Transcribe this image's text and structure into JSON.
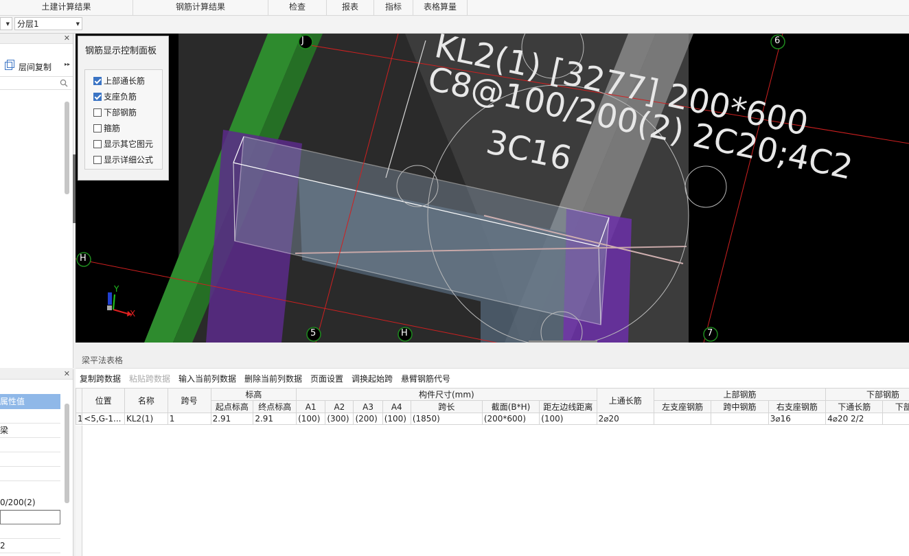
{
  "top_tabs": [
    "土建计算结果",
    "钢筋计算结果",
    "检查",
    "报表",
    "指标",
    "表格算量"
  ],
  "floor_select": "分层1",
  "left_panel": {
    "layer_copy": "层间复制",
    "expand_glyph": "▸▸",
    "search_icon": "search-icon",
    "prop_header": "属性值",
    "prop_values": [
      "",
      "梁",
      "",
      "",
      "",
      "0/200(2)",
      "",
      "",
      "2"
    ]
  },
  "control_panel": {
    "title": "钢筋显示控制面板",
    "items": [
      {
        "label": "上部通长筋",
        "checked": true
      },
      {
        "label": "支座负筋",
        "checked": true
      },
      {
        "label": "下部钢筋",
        "checked": false
      },
      {
        "label": "箍筋",
        "checked": false
      },
      {
        "label": "显示其它图元",
        "checked": false
      },
      {
        "label": "显示详细公式",
        "checked": false
      }
    ]
  },
  "viewport": {
    "annotation_lines": [
      "KL2(1) [3277] 200*600",
      "C8@100/200(2) 2C20;4C2",
      "3C16"
    ],
    "axis_markers": [
      "J",
      "6",
      "H",
      "5",
      "H",
      "7"
    ],
    "axes": {
      "x": "X",
      "y": "Y"
    },
    "colors": {
      "beam_purple": "#6b2fa8",
      "column_green": "#2e8b2e",
      "grid_line": "#d02020",
      "axis_marker": "#1e8a1e"
    }
  },
  "bottom_panel": {
    "title": "梁平法表格",
    "toolbar": [
      {
        "label": "复制跨数据",
        "enabled": true
      },
      {
        "label": "粘贴跨数据",
        "enabled": false
      },
      {
        "label": "输入当前列数据",
        "enabled": true
      },
      {
        "label": "删除当前列数据",
        "enabled": true
      },
      {
        "label": "页面设置",
        "enabled": true
      },
      {
        "label": "调换起始跨",
        "enabled": true
      },
      {
        "label": "悬臂钢筋代号",
        "enabled": true
      }
    ],
    "group_headers": {
      "elevation": "标高",
      "size": "构件尺寸(mm)",
      "top_rebar": "上部钢筋",
      "bottom_rebar": "下部钢筋"
    },
    "col_headers": {
      "position": "位置",
      "name": "名称",
      "span_no": "跨号",
      "start_elev": "起点标高",
      "end_elev": "终点标高",
      "a1": "A1",
      "a2": "A2",
      "a3": "A3",
      "a4": "A4",
      "span_len": "跨长",
      "section": "截面(B*H)",
      "edge_dist": "距左边线距离",
      "top_long": "上通长筋",
      "left_support": "左支座钢筋",
      "mid": "跨中钢筋",
      "right_support": "右支座钢筋",
      "bot_long": "下通长筋",
      "bot_rebar": "下部钢筋"
    },
    "rows": [
      {
        "idx": "1",
        "position": "<5,G-1...",
        "name": "KL2(1)",
        "span_no": "1",
        "start_elev": "2.91",
        "end_elev": "2.91",
        "a1": "(100)",
        "a2": "(300)",
        "a3": "(200)",
        "a4": "(100)",
        "span_len": "(1850)",
        "section": "(200*600)",
        "edge_dist": "(100)",
        "top_long": "2⌀20",
        "left_support": "",
        "mid": "",
        "right_support": "3⌀16",
        "bot_long": "4⌀20 2/2",
        "bot_rebar": ""
      }
    ]
  }
}
